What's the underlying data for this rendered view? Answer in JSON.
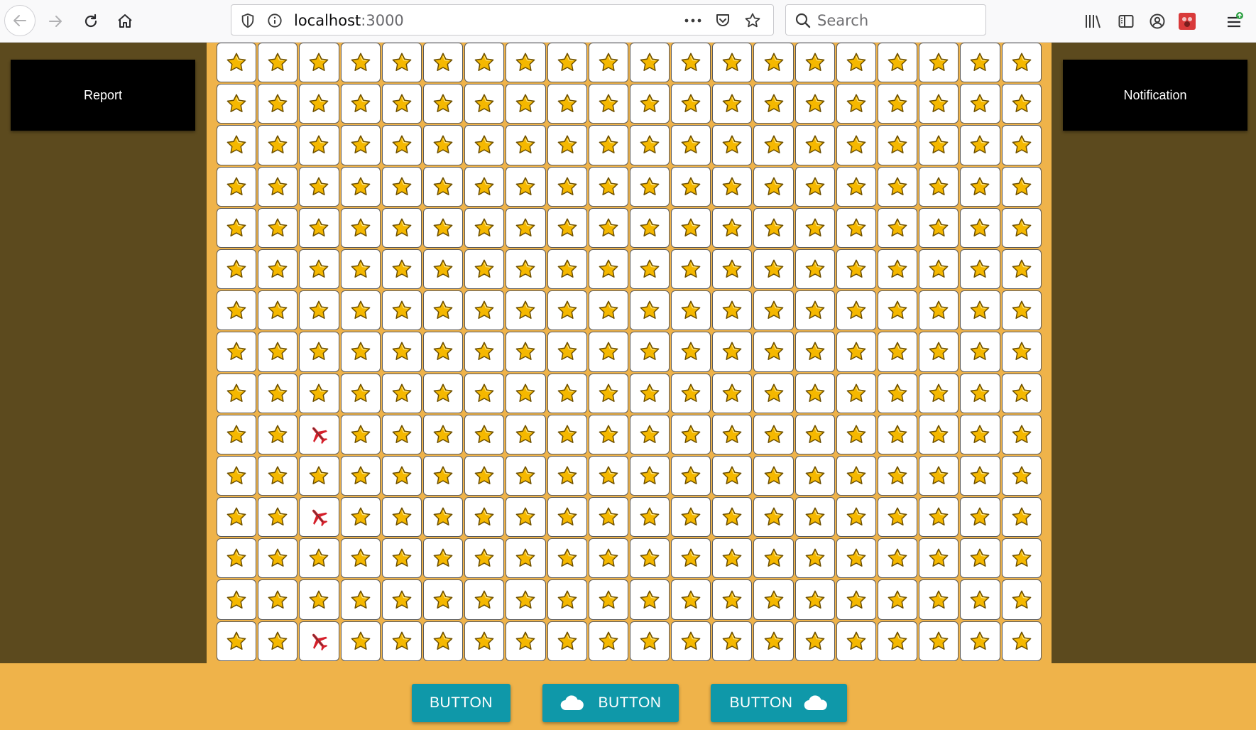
{
  "browser": {
    "url_host": "localhost",
    "url_port": ":3000",
    "search_placeholder": "Search"
  },
  "left_panel": {
    "report_label": "Report"
  },
  "right_panel": {
    "notification_label": "Notification"
  },
  "grid": {
    "rows": 15,
    "cols": 20,
    "default_cell": "star-icon",
    "planes": [
      {
        "row": 10,
        "col": 3
      },
      {
        "row": 12,
        "col": 3
      },
      {
        "row": 15,
        "col": 3
      }
    ]
  },
  "footer": {
    "buttons": [
      {
        "label": "BUTTON",
        "icon": "none"
      },
      {
        "label": "BUTTON",
        "icon": "cloud-icon-left"
      },
      {
        "label": "BUTTON",
        "icon": "cloud-icon-right"
      }
    ]
  },
  "colors": {
    "page_bg": "#efb34a",
    "side_panel": "#5c4a1e",
    "button_teal": "#0f98a9",
    "side_button": "#000000"
  }
}
